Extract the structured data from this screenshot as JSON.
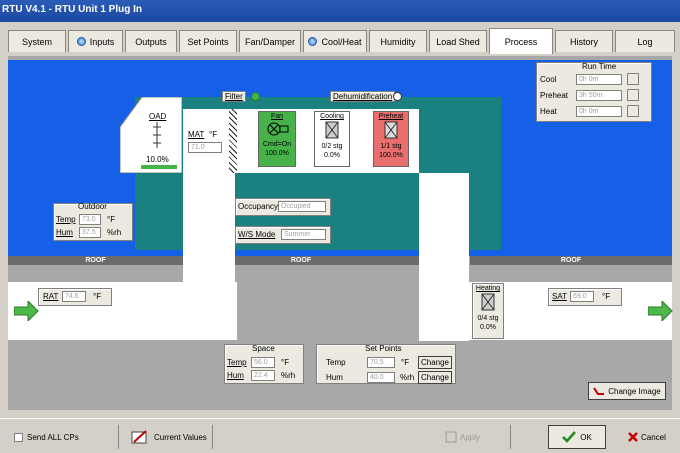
{
  "window": {
    "title": "RTU V4.1 - RTU Unit 1 Plug In"
  },
  "tabs": [
    "System",
    "Inputs",
    "Outputs",
    "Set Points",
    "Fan/Damper",
    "Cool/Heat",
    "Humidity",
    "Load Shed",
    "Process",
    "History",
    "Log"
  ],
  "diagram": {
    "roof_label": "ROOF",
    "filter_label": "Filter",
    "dehumidification_label": "Dehumidification",
    "oad": {
      "label": "OAD",
      "value": "10.0%"
    },
    "mat": {
      "label": "MAT",
      "unit": "°F",
      "value": "71.0"
    },
    "fan": {
      "label": "Fan",
      "line1": "Cmd=On",
      "line2": "100.0%"
    },
    "cooling": {
      "label": "Cooling",
      "line1": "0/2 stg",
      "line2": "0.0%"
    },
    "preheat": {
      "label": "Preheat",
      "line1": "1/1 stg",
      "line2": "100.0%"
    },
    "outdoor": {
      "title": "Outdoor",
      "temp_label": "Temp",
      "temp_value": "73.0",
      "temp_unit": "°F",
      "hum_label": "Hum",
      "hum_value": "37.5",
      "hum_unit": "%rh"
    },
    "occupancy": {
      "label": "Occupancy",
      "value": "Occupied"
    },
    "ws_mode": {
      "label": "W/S Mode",
      "value": "Summer"
    },
    "rat": {
      "label": "RAT",
      "value": "74.6",
      "unit": "°F"
    },
    "sat": {
      "label": "SAT",
      "value": "69.0",
      "unit": "°F"
    },
    "heating": {
      "label": "Heating",
      "line1": "0/4 stg",
      "line2": "0.0%"
    },
    "space": {
      "title": "Space",
      "temp_label": "Temp",
      "temp_value": "56.0",
      "temp_unit": "°F",
      "hum_label": "Hum",
      "hum_value": "22.4",
      "hum_unit": "%rh"
    },
    "set_points": {
      "title": "Set Points",
      "temp_label": "Temp",
      "temp_value": "70.5",
      "temp_unit": "°F",
      "hum_label": "Hum",
      "hum_value": "40.0",
      "hum_unit": "%rh",
      "change_label": "Change"
    },
    "run_time": {
      "title": "Run Time",
      "cool_label": "Cool",
      "cool_value": "0h 0m",
      "preheat_label": "Preheat",
      "preheat_value": "3h 50m",
      "heat_label": "Heat",
      "heat_value": "0h 0m"
    },
    "change_image_label": "Change Image"
  },
  "footer": {
    "send_all_label": "Send ALL CPs",
    "current_values_label": "Current Values",
    "apply_label": "Apply",
    "ok_label": "OK",
    "cancel_label": "Cancel"
  },
  "colors": {
    "sky": "#1560e6",
    "teal": "#1b8080",
    "fan_active": "#46b249",
    "preheat_active": "#e96e6e",
    "titlebar": "#1b47a0"
  }
}
